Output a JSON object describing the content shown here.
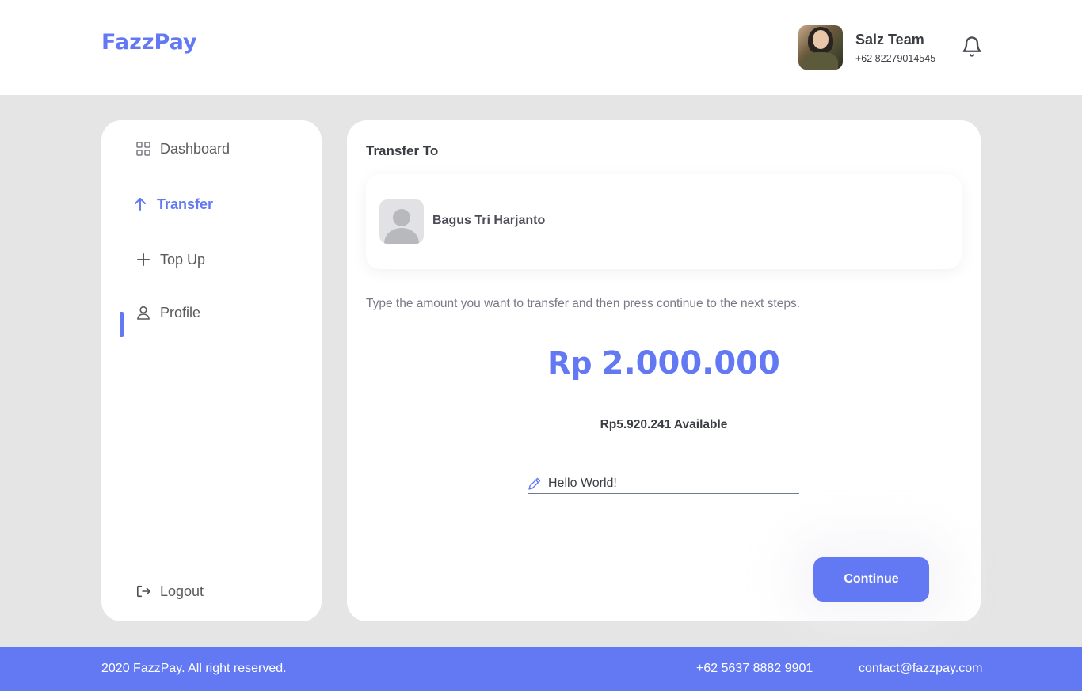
{
  "header": {
    "brand": "FazzPay",
    "user": {
      "name": "Salz Team",
      "phone": "+62 82279014545"
    }
  },
  "sidebar": {
    "items": [
      {
        "label": "Dashboard",
        "icon": "grid-icon",
        "active": false
      },
      {
        "label": "Transfer",
        "icon": "arrow-up-icon",
        "active": true
      },
      {
        "label": "Top Up",
        "icon": "plus-icon",
        "active": false
      },
      {
        "label": "Profile",
        "icon": "user-icon",
        "active": false
      }
    ],
    "logout": {
      "label": "Logout",
      "icon": "logout-icon"
    }
  },
  "main": {
    "title": "Transfer To",
    "recipient": {
      "name": "Bagus Tri Harjanto"
    },
    "instructions": "Type the amount you want to transfer and then press continue to the next steps.",
    "amount": {
      "currency": "Rp",
      "value": "2.000.000"
    },
    "available": "Rp5.920.241 Available",
    "note": {
      "value": "Hello World!"
    },
    "continue_label": "Continue"
  },
  "footer": {
    "copyright": "2020 FazzPay. All right reserved.",
    "phone": "+62 5637 8882 9901",
    "email": "contact@fazzpay.com"
  },
  "colors": {
    "accent": "#6379f4",
    "background": "#e5e5e5",
    "card": "#ffffff",
    "text": "#3a3d42"
  }
}
